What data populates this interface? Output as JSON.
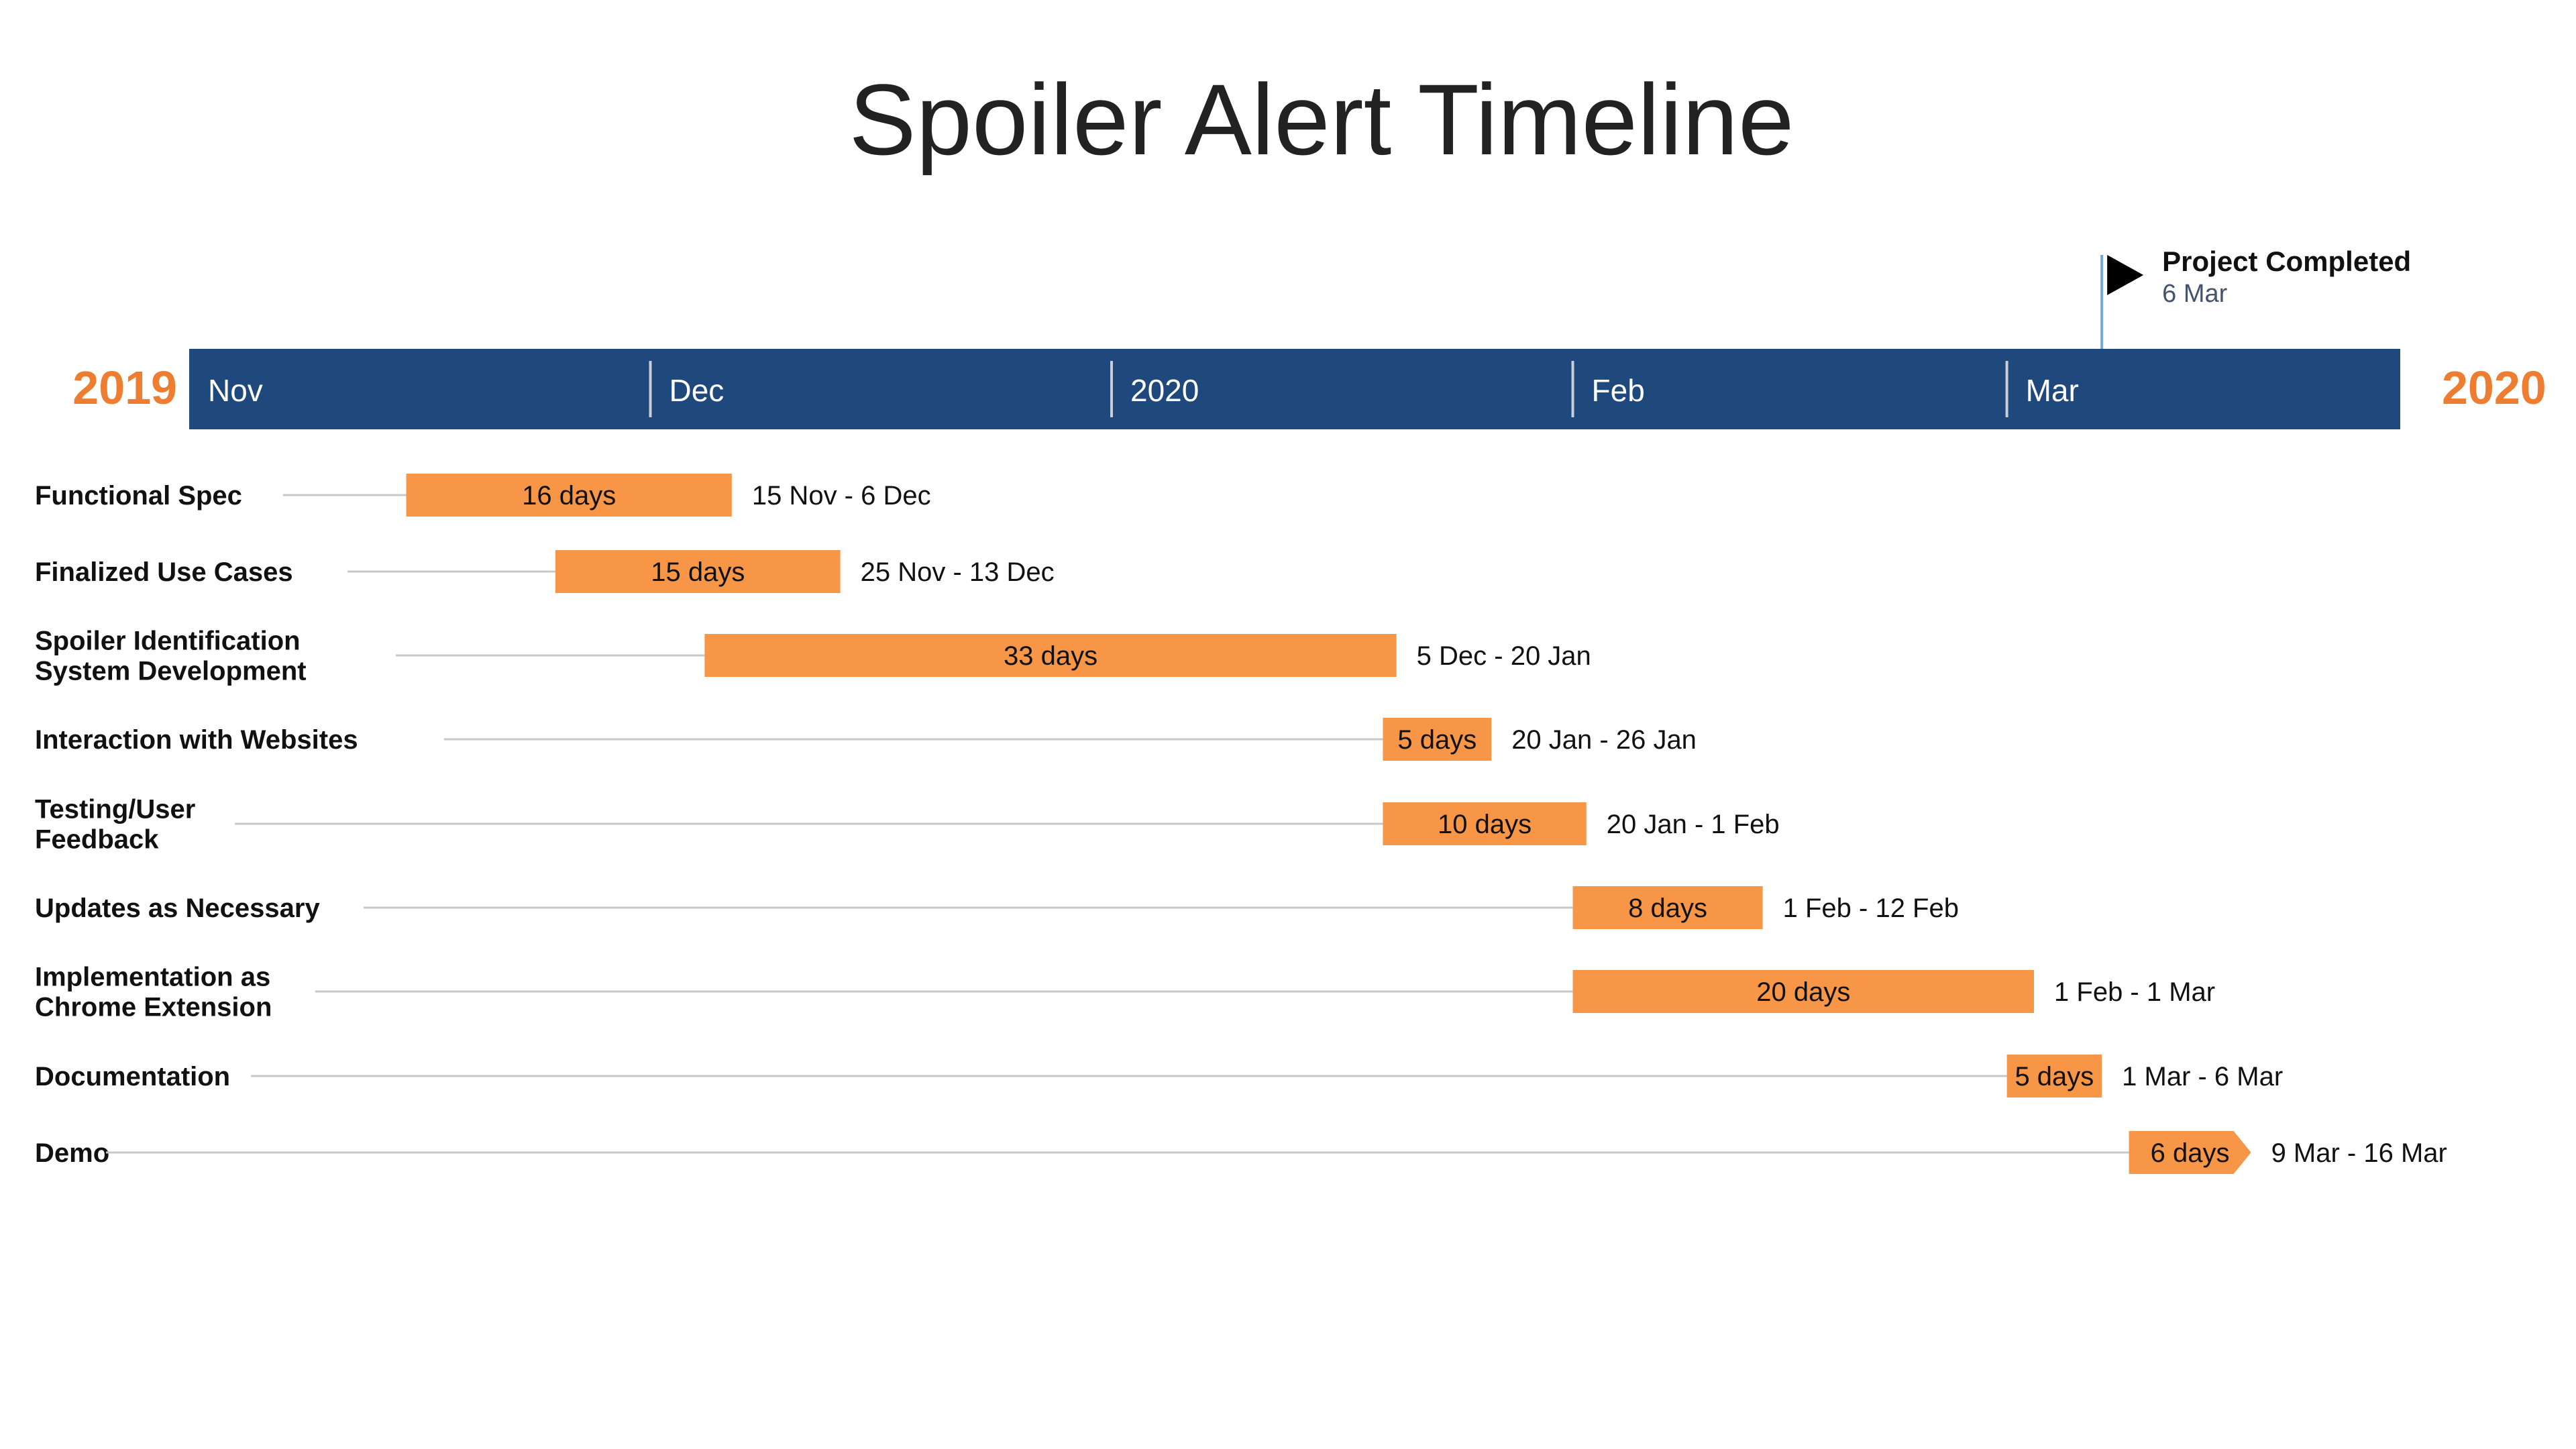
{
  "title": "Spoiler Alert Timeline",
  "colors": {
    "bar": "#F79646",
    "band": "#1F497D",
    "year": "#ED7D31",
    "band_text": "#FFFFFF",
    "divider": "#C9CED8",
    "leader": "#C8C8C8",
    "milestone_line": "#6FA8DC",
    "milestone_date": "#44546A"
  },
  "chart_data": {
    "type": "gantt",
    "title": "Spoiler Alert Timeline",
    "timeline": {
      "start": "2019-10-17",
      "end": "2020-03-28",
      "start_year_label": "2019",
      "end_year_label": "2020",
      "ticks": [
        {
          "date": "2019-10-17",
          "label": "Nov"
        },
        {
          "date": "2019-11-20",
          "label": "Dec"
        },
        {
          "date": "2019-12-24",
          "label": "2020"
        },
        {
          "date": "2020-01-27",
          "label": "Feb"
        },
        {
          "date": "2020-02-28",
          "label": "Mar"
        }
      ]
    },
    "milestone": {
      "label": "Project Completed",
      "date_label": "6 Mar",
      "date": "2020-03-06"
    },
    "tasks": [
      {
        "name": "Functional Spec",
        "start": "2019-11-02",
        "end": "2019-11-26",
        "duration_label": "16 days",
        "range_label": "15 Nov - 6 Dec"
      },
      {
        "name": "Finalized Use Cases",
        "start": "2019-11-13",
        "end": "2019-12-04",
        "duration_label": "15 days",
        "range_label": "25 Nov - 13 Dec"
      },
      {
        "name": "Spoiler Identification\nSystem Development",
        "start": "2019-11-24",
        "end": "2020-01-14",
        "duration_label": "33 days",
        "range_label": "5 Dec - 20 Jan"
      },
      {
        "name": "Interaction with Websites",
        "start": "2020-01-13",
        "end": "2020-01-21",
        "duration_label": "5 days",
        "range_label": "20 Jan - 26 Jan"
      },
      {
        "name": "Testing/User\nFeedback",
        "start": "2020-01-13",
        "end": "2020-01-28",
        "duration_label": "10 days",
        "range_label": "20 Jan - 1 Feb"
      },
      {
        "name": "Updates as Necessary",
        "start": "2020-01-27",
        "end": "2020-02-10",
        "duration_label": "8 days",
        "range_label": "1 Feb - 12 Feb"
      },
      {
        "name": "Implementation as\nChrome Extension",
        "start": "2020-01-27",
        "end": "2020-03-01",
        "duration_label": "20 days",
        "range_label": "1 Feb - 1 Mar"
      },
      {
        "name": "Documentation",
        "start": "2020-02-28",
        "end": "2020-03-06",
        "duration_label": "5 days",
        "range_label": "1 Mar - 6 Mar"
      },
      {
        "name": "Demo",
        "start": "2020-03-08",
        "end": "2020-03-17",
        "duration_label": "6 days",
        "range_label": "9 Mar - 16 Mar",
        "arrow": true
      }
    ]
  }
}
